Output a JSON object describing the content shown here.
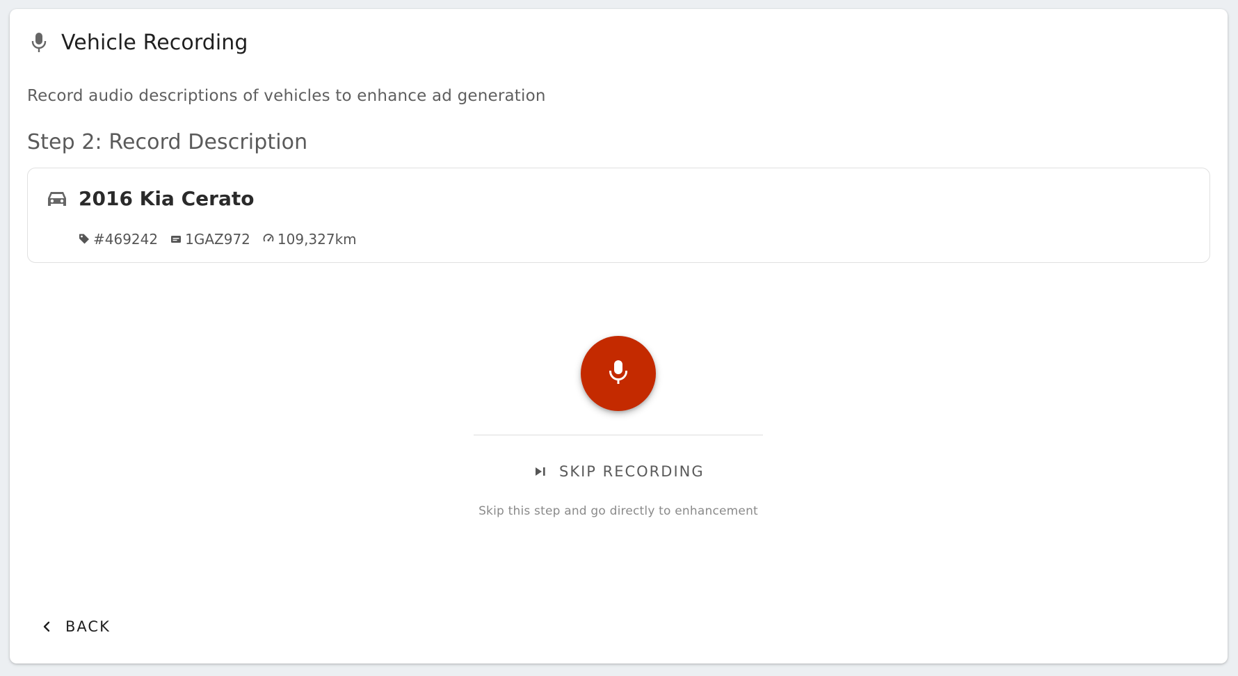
{
  "header": {
    "icon": "microphone-icon",
    "title": "Vehicle Recording"
  },
  "subtitle": "Record audio descriptions of vehicles to enhance ad generation",
  "step": {
    "title": "Step 2: Record Description"
  },
  "vehicle": {
    "icon": "car-icon",
    "name": "2016 Kia Cerato",
    "meta": {
      "stock": "#469242",
      "plate": "1GAZ972",
      "odometer": "109,327km"
    }
  },
  "record": {
    "icon": "microphone-icon",
    "color": "#c42a00"
  },
  "skip": {
    "icon": "skip-next-icon",
    "label": "SKIP RECORDING",
    "help": "Skip this step and go directly to enhancement"
  },
  "back": {
    "icon": "chevron-left-icon",
    "label": "BACK"
  }
}
